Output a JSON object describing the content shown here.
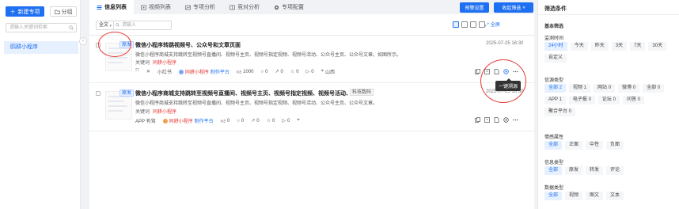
{
  "sidebar": {
    "new_project": "新建专项",
    "group": "分组",
    "keyword_placeholder": "请输入关键词检索",
    "project_item": "鸥耕小程序"
  },
  "tabs": [
    {
      "label": "信息列表",
      "icon": "list-icon"
    },
    {
      "label": "视频列表",
      "icon": "video-icon"
    },
    {
      "label": "专项分析",
      "icon": "chart-icon"
    },
    {
      "label": "竞对分析",
      "icon": "compare-icon"
    },
    {
      "label": "专项配置",
      "icon": "gear-icon"
    }
  ],
  "header_buttons": {
    "warning_settings": "预警设置",
    "collapse_filter": "收起筛选"
  },
  "toolbar": {
    "scope": "全文",
    "search_placeholder": "请输入",
    "fullscreen": "全屏"
  },
  "items": [
    {
      "type_badge": "原发",
      "title": "微信小程序转跳视频号、公众号和文章页面",
      "desc": "微信小程序商城支持跳转至视频号直播间、视频号主页、视频号指定视频、视频号活动、公众号主页、公众号文章。如图所示。",
      "keyword_label": "关键词",
      "keyword_value": "同耕小程序",
      "time": "2025-07-25 16:30",
      "platform": "小红书",
      "author": "同耕小程序",
      "author_suffix": "制作平台",
      "likes": "1000",
      "comments": "0",
      "shares": "0",
      "collects": "0",
      "plays": "0",
      "location": "山西"
    },
    {
      "type_badge": "原发",
      "title": "微信小程序商城支持跳转至视频号直播间、视频号主页、视频号指定视频、视频号活动、...",
      "tag": "科技数码",
      "desc": "微信小程序商城支持跳转至视频号直播间、视频号主页、视频号指定视频、视频号活动、公众号主页、公众号文章。",
      "keyword_label": "关键词",
      "keyword_value": "同耕小程序",
      "time": "2025-07-25 16:30",
      "platform": "APP 有驾",
      "author": "同耕小程序",
      "author_suffix": "制作平台",
      "likes": "0",
      "comments": "0",
      "shares": "0",
      "collects": "0",
      "plays": "0"
    }
  ],
  "tooltip": "一键溯源",
  "filters": {
    "title": "筛选条件",
    "basic": "基本筛选",
    "time_label": "监测时间",
    "time_opts": [
      "24小时",
      "今天",
      "昨天",
      "3天",
      "7天",
      "30天",
      "自定义"
    ],
    "source_label": "信源类型",
    "source_opts": [
      "全部 2",
      "视频 1",
      "网站 0",
      "微博 0",
      "全部 0",
      "APP 1",
      "电子报 0",
      "论坛 0",
      "问答 0",
      "聚合平台 0"
    ],
    "sentiment_label": "情感属性",
    "sentiment_opts": [
      "全部",
      "正面",
      "中性",
      "负面"
    ],
    "info_label": "信息类型",
    "info_opts": [
      "全部",
      "原发",
      "转发",
      "评论"
    ],
    "data_label": "数据类型",
    "data_opts": [
      "全部",
      "视频",
      "图文",
      "文本"
    ]
  },
  "colors": {
    "accent": "#1e6ff1",
    "highlight": "#e53935"
  }
}
